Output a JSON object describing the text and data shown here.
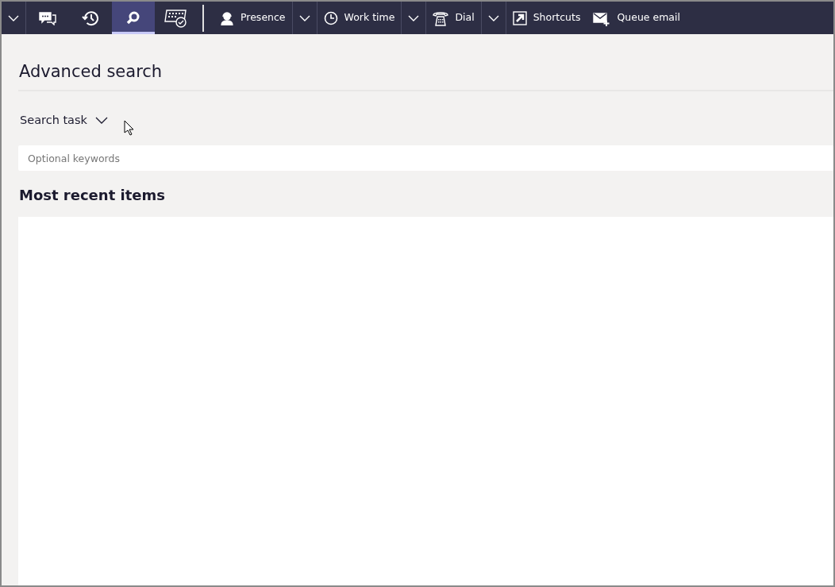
{
  "toolbar": {
    "tabs": [
      {
        "selected": false
      },
      {
        "selected": false
      },
      {
        "selected": true
      },
      {
        "selected": false
      }
    ],
    "commands": [
      {
        "label": "Presence",
        "split": true
      },
      {
        "label": "Work time",
        "split": true
      },
      {
        "label": "Dial",
        "split": true
      },
      {
        "label": "Shortcuts",
        "split": false
      },
      {
        "label": "Queue email",
        "split": false
      }
    ]
  },
  "page": {
    "title": "Advanced search",
    "task_menu": {
      "label": "Search task"
    },
    "search": {
      "placeholder": "Optional keywords"
    },
    "recent": {
      "heading": "Most recent items"
    }
  }
}
